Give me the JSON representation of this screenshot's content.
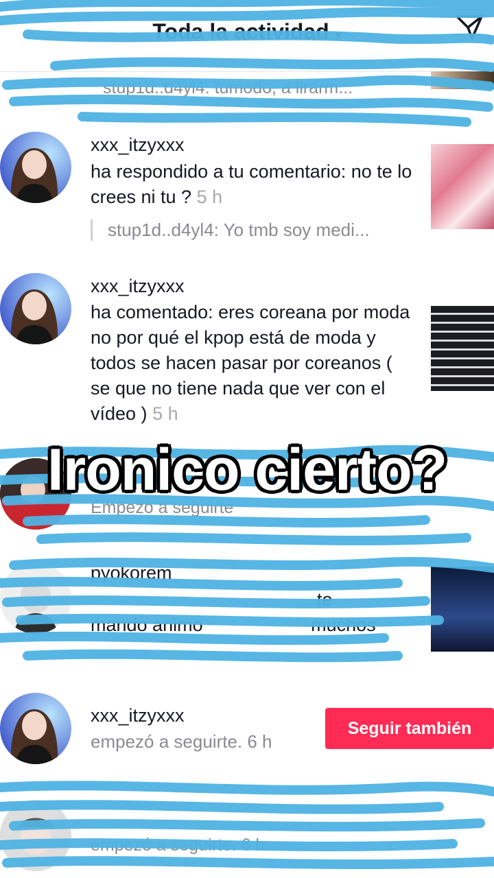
{
  "header": {
    "title": "Toda la actividad",
    "dropdown_icon": "chevron-down-icon",
    "send_icon": "send-icon"
  },
  "notifications": [
    {
      "fragment": "stup1d..d4yl4: tumodo, a lirarm..."
    },
    {
      "username": "xxx_itzyxxx",
      "text": "ha respondido a tu comentario: no te lo crees ni tu ?",
      "time": "5 h",
      "quote": "stup1d..d4yl4: Yo tmb soy medi..."
    },
    {
      "username": "xxx_itzyxxx",
      "text": "ha comentado: eres coreana por moda no por qué el kpop está de moda y todos se hacen pasar por coreanos ( se que no tiene nada que ver con el vídeo )",
      "time": "5 h"
    },
    {
      "fragment": "Empezó a seguirte"
    },
    {
      "username": "pyokorem",
      "fragment_1": "te",
      "fragment_2": "mando animo",
      "fragment_3": "muchos"
    },
    {
      "username": "xxx_itzyxxx",
      "text": "empezó a seguirte.",
      "time": "6 h",
      "button": "Seguir también"
    },
    {
      "fragment": "empezó a seguirte. 6 h"
    }
  ],
  "overlay_caption": "Ironico cierto?",
  "colors": {
    "scribble": "#4fb3e3",
    "follow": "#fe2c55"
  }
}
